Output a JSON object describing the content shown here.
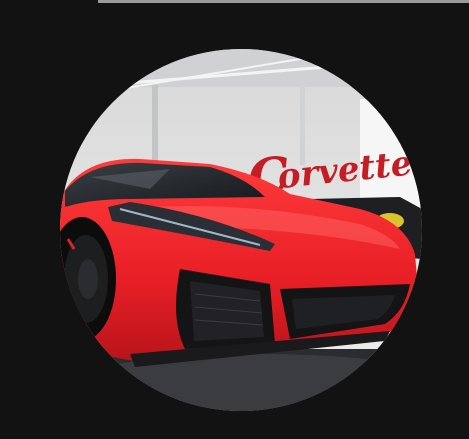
{
  "photo": {
    "subject": "red-sports-car",
    "wall_lettering": "Corvette",
    "colors": {
      "background": "#121212",
      "car_red": "#e8202a",
      "wall": "#e6e6e6",
      "lettering": "#c41e24"
    }
  }
}
